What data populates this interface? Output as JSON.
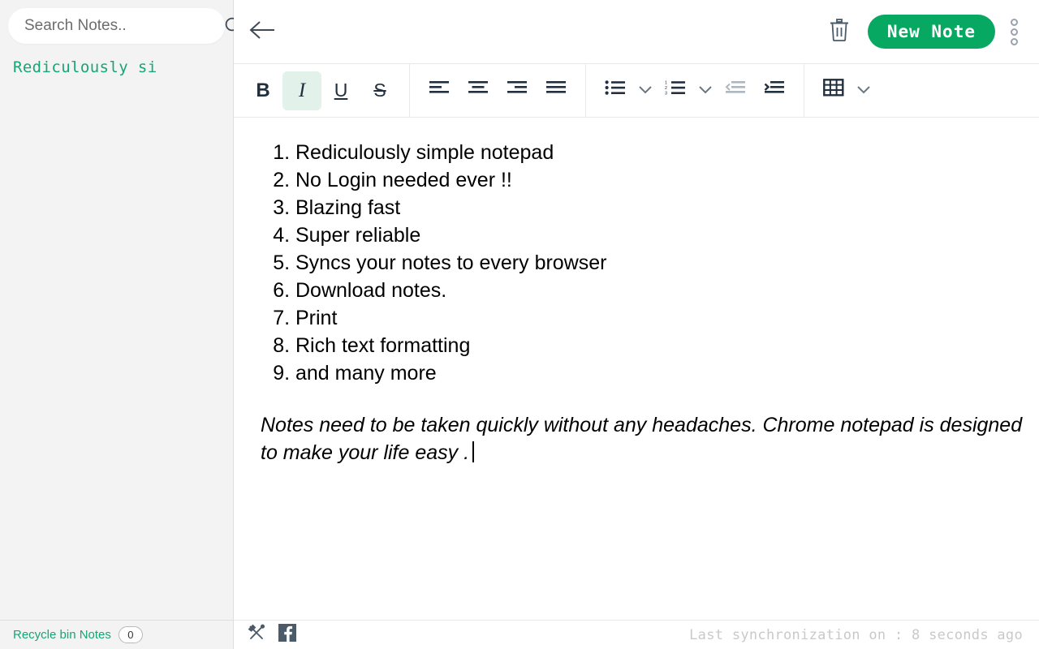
{
  "colors": {
    "accent_green": "#06a862",
    "note_title_green": "#16a673",
    "toolbar_icon": "#222f3e",
    "toolbar_icon_disabled": "#aeb6bf",
    "active_button_bg": "#e2f2ea",
    "sidebar_bg": "#f3f3f3",
    "sync_text": "#c9c9c9"
  },
  "sidebar": {
    "search": {
      "placeholder": "Search Notes..",
      "value": "",
      "icon": "search-icon"
    },
    "notes": [
      {
        "title": "Rediculously si"
      }
    ],
    "footer": {
      "recycle_bin_label": "Recycle bin Notes",
      "recycle_bin_count": "0"
    }
  },
  "topbar": {
    "back_icon": "arrow-left-icon",
    "trash_icon": "trash-icon",
    "new_note_label": "New Note",
    "kebab_icon": "more-vertical-icon"
  },
  "format_toolbar": {
    "buttons": [
      {
        "name": "bold",
        "glyph": "B",
        "active": false
      },
      {
        "name": "italic",
        "glyph": "I",
        "active": true
      },
      {
        "name": "underline",
        "glyph": "U",
        "active": false
      },
      {
        "name": "strikethrough",
        "glyph": "S",
        "active": false
      },
      {
        "name": "align-left",
        "icon": "align-left-icon",
        "active": false
      },
      {
        "name": "align-center",
        "icon": "align-center-icon",
        "active": false
      },
      {
        "name": "align-right",
        "icon": "align-right-icon",
        "active": false
      },
      {
        "name": "align-justify",
        "icon": "align-justify-icon",
        "active": false
      },
      {
        "name": "bullet-list",
        "icon": "bullet-list-icon",
        "active": false
      },
      {
        "name": "numbered-list",
        "icon": "numbered-list-icon",
        "active": false
      },
      {
        "name": "outdent",
        "icon": "outdent-icon",
        "disabled": true
      },
      {
        "name": "indent",
        "icon": "indent-icon",
        "disabled": false
      },
      {
        "name": "table",
        "icon": "table-icon",
        "active": false
      }
    ]
  },
  "editor": {
    "list_items": [
      "Rediculously simple notepad",
      "No Login needed ever !!",
      "Blazing fast",
      "Super reliable",
      "Syncs your notes to every browser",
      "Download notes.",
      "Print",
      "Rich text formatting",
      "and many more"
    ],
    "paragraph": "Notes need to be taken quickly without any headaches. Chrome notepad is designed to make your life easy ."
  },
  "bottombar": {
    "tools_icon": "tools-icon",
    "facebook_icon": "facebook-icon",
    "sync_status": "Last synchronization on : 8 seconds ago"
  }
}
